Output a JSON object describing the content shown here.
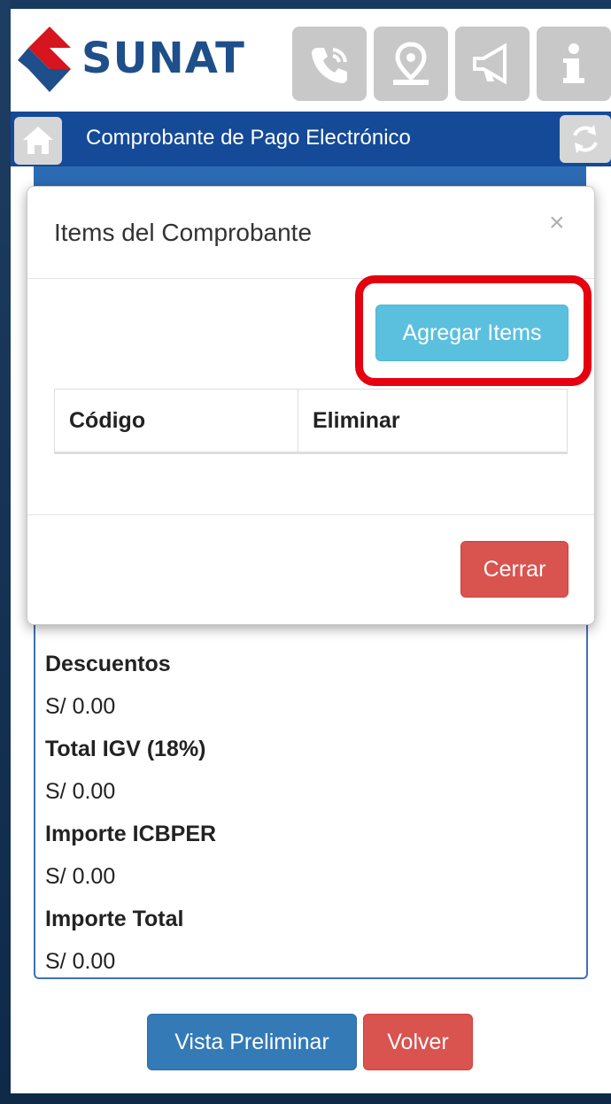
{
  "header": {
    "logo_text": "SUNAT",
    "icons": [
      "phone-icon",
      "location-icon",
      "megaphone-icon",
      "info-icon"
    ]
  },
  "nav": {
    "title": "Comprobante de Pago Electrónico",
    "home_icon": "home-icon",
    "refresh_icon": "refresh-icon"
  },
  "modal": {
    "title": "Items del Comprobante",
    "close_symbol": "×",
    "add_button": "Agregar Items",
    "table_headers": [
      "Código",
      "Eliminar"
    ],
    "close_button": "Cerrar"
  },
  "summary": {
    "partial_value": "S/   0.00",
    "rows": [
      {
        "label": "Descuentos",
        "value": "S/   0.00"
      },
      {
        "label": "Total IGV (18%)",
        "value": "S/   0.00"
      },
      {
        "label": "Importe ICBPER",
        "value": "S/   0.00"
      },
      {
        "label": "Importe Total",
        "value": "S/   0.00"
      }
    ]
  },
  "footer": {
    "preview_button": "Vista Preliminar",
    "back_button": "Volver"
  },
  "colors": {
    "navbar": "#144a98",
    "primary": "#337ab7",
    "info": "#5bc0de",
    "danger": "#d9534f",
    "highlight": "#e6000f",
    "logo_red": "#d7151f",
    "logo_blue": "#1f4f8a"
  }
}
